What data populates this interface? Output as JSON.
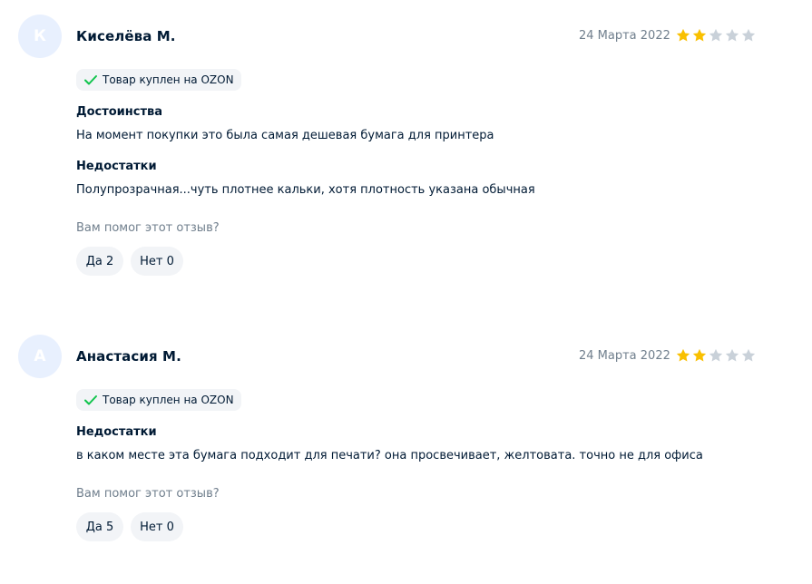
{
  "reviews": [
    {
      "avatar_letter": "К",
      "author": "Киселёва М.",
      "date": "24 Марта 2022",
      "rating": 2,
      "badge": "Товар куплен на OZON",
      "sections": [
        {
          "title": "Достоинства",
          "text": "На момент покупки это была самая дешевая бумага для принтера"
        },
        {
          "title": "Недостатки",
          "text": "Полупрозрачная...чуть плотнее кальки, хотя плотность указана обычная"
        }
      ],
      "helpful_question": "Вам помог этот отзыв?",
      "yes_label": "Да 2",
      "no_label": "Нет 0"
    },
    {
      "avatar_letter": "А",
      "author": "Анастасия М.",
      "date": "24 Марта 2022",
      "rating": 2,
      "badge": "Товар куплен на OZON",
      "sections": [
        {
          "title": "Недостатки",
          "text": "в каком месте эта бумага подходит для печати? она просвечивает, желтовата. точно не для офиса"
        }
      ],
      "helpful_question": "Вам помог этот отзыв?",
      "yes_label": "Да 5",
      "no_label": "Нет 0"
    }
  ],
  "colors": {
    "star_filled": "#f9c000",
    "star_empty": "#c9d1d9",
    "check": "#10c44c",
    "avatar_bg": "#e8f0fe"
  },
  "icons": {
    "star": "star-icon",
    "check": "check-icon"
  }
}
